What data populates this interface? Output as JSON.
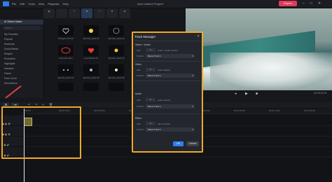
{
  "menu": [
    "File",
    "Edit",
    "Tools",
    "View",
    "Playback",
    "Help"
  ],
  "window_title": "New Untitled Project*",
  "export_label": "Export",
  "sidebar": {
    "title": "AI Sticker Maker",
    "search_placeholder": "Search",
    "items": [
      "My Favorites",
      "Popular",
      "Seasonal",
      "Social Media",
      "Shapes",
      "Promotion",
      "Highlights",
      "Interface",
      "Frame",
      "Face Cover",
      "Decorations"
    ]
  },
  "stickers": {
    "labels": [
      "Nitrogen FSF 02",
      "Special_Label 01",
      "Special_Label 02",
      "Animation Elm",
      "Love Bricks 01",
      "Special_Label 03",
      "Special_Label 04",
      "Special_Label 05",
      "Special_Label 06"
    ]
  },
  "dialog": {
    "title": "Track Manager",
    "sections": [
      {
        "title": "Video + Audio",
        "add_label": "Add",
        "count": "1",
        "hint": "video + audio track(s)",
        "position_label": "Position",
        "position_value": "Below Track 1"
      },
      {
        "title": "Video",
        "add_label": "Add",
        "count": "1",
        "hint": "video track(s)",
        "position_label": "Position",
        "position_value": "Below Track 1"
      },
      {
        "title": "Audio",
        "add_label": "Add",
        "count": "1",
        "hint": "audio track(s)",
        "position_label": "Position",
        "position_value": "Below Track 1"
      },
      {
        "title": "Effect",
        "add_label": "Add",
        "count": "1",
        "hint": "effect track(s)",
        "position_label": "Position",
        "position_value": "Below Track 1"
      }
    ],
    "ok_label": "OK",
    "cancel_label": "Cancel"
  },
  "player": {
    "timecode": "00:00:00:00"
  },
  "ruler_ticks": [
    "00:00",
    "00:00:10:00",
    "00:00:20:00",
    "00:00:30:00",
    "00:00:40:00",
    "00:00:50:00",
    "00:01:00:00",
    "00:01:10:00",
    "00:01:20:00"
  ],
  "colors": {
    "accent_orange": "#f0a829",
    "brand_blue": "#2f7ff0",
    "export_pink": "#e13b5a",
    "arrow_red": "#e0413a"
  }
}
